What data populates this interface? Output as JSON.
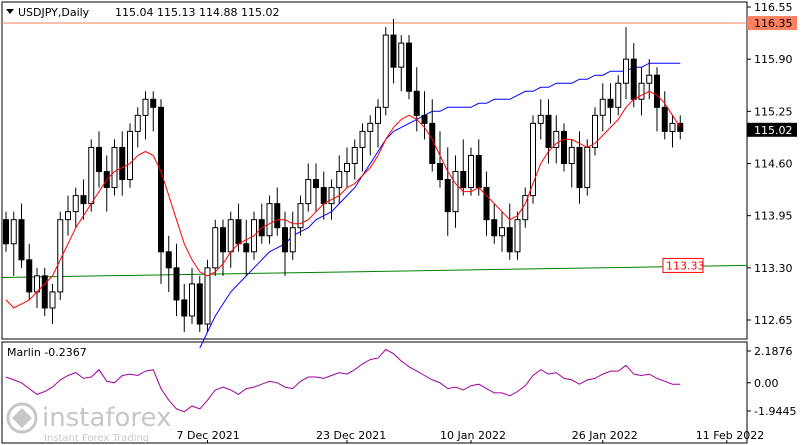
{
  "header": {
    "symbol": "USDJPY,Daily",
    "ohlc": "115.04 115.13 114.88 115.02"
  },
  "indicator": {
    "label": "Marlin -0.2367",
    "ticks": [
      "2.1876",
      "0.00",
      "-1.9445"
    ],
    "values": [
      2.1876,
      0.0,
      -1.9445
    ]
  },
  "watermark": {
    "brand": "instaforex",
    "tagline": "Instant Forex Trading"
  },
  "colors": {
    "ma_fast": "#ff0000",
    "ma_slow": "#0000ff",
    "ma_long": "#008000",
    "marlin": "#a000a0",
    "resistance": "#ff8060",
    "box_red": "#ff0000"
  },
  "chart_data": {
    "type": "candlestick",
    "price_ticks": [
      "116.55",
      "115.90",
      "115.25",
      "114.60",
      "113.95",
      "113.30",
      "112.65"
    ],
    "price_tick_values": [
      116.55,
      115.9,
      115.25,
      114.6,
      113.95,
      113.3,
      112.65
    ],
    "date_labels": [
      "7 Dec 2021",
      "23 Dec 2021",
      "10 Jan 2022",
      "26 Jan 2022",
      "11 Feb 2022"
    ],
    "date_label_index": [
      26,
      44,
      60,
      77,
      93
    ],
    "current_price": "115.02",
    "resistance_label": "116.35",
    "resistance_value": 116.35,
    "long_ma_label": "113.33",
    "candles": [
      [
        113.9,
        114.0,
        113.5,
        113.6
      ],
      [
        113.6,
        114.0,
        113.2,
        113.9
      ],
      [
        113.9,
        114.1,
        113.3,
        113.4
      ],
      [
        113.4,
        113.6,
        112.9,
        113.0
      ],
      [
        113.0,
        113.3,
        112.8,
        113.2
      ],
      [
        113.2,
        113.3,
        112.7,
        112.8
      ],
      [
        112.8,
        113.1,
        112.6,
        113.0
      ],
      [
        113.0,
        114.0,
        112.9,
        113.9
      ],
      [
        113.9,
        114.2,
        113.7,
        114.0
      ],
      [
        114.0,
        114.3,
        113.8,
        114.2
      ],
      [
        114.2,
        114.4,
        113.9,
        114.1
      ],
      [
        114.1,
        114.9,
        114.0,
        114.8
      ],
      [
        114.8,
        115.0,
        114.3,
        114.5
      ],
      [
        114.5,
        114.7,
        114.0,
        114.3
      ],
      [
        114.3,
        114.9,
        114.2,
        114.8
      ],
      [
        114.8,
        115.0,
        114.2,
        114.4
      ],
      [
        114.4,
        115.1,
        114.3,
        115.0
      ],
      [
        115.0,
        115.3,
        114.8,
        115.2
      ],
      [
        115.2,
        115.5,
        114.9,
        115.4
      ],
      [
        115.4,
        115.5,
        115.0,
        115.3
      ],
      [
        115.3,
        115.4,
        113.1,
        113.5
      ],
      [
        113.5,
        113.7,
        113.0,
        113.3
      ],
      [
        113.3,
        113.6,
        112.7,
        112.9
      ],
      [
        112.9,
        113.1,
        112.5,
        112.7
      ],
      [
        112.7,
        113.3,
        112.6,
        113.1
      ],
      [
        113.1,
        113.2,
        112.5,
        112.6
      ],
      [
        112.6,
        113.4,
        112.5,
        113.3
      ],
      [
        113.3,
        113.9,
        113.2,
        113.8
      ],
      [
        113.8,
        113.9,
        113.2,
        113.5
      ],
      [
        113.5,
        114.0,
        113.3,
        113.9
      ],
      [
        113.9,
        114.1,
        113.5,
        113.6
      ],
      [
        113.6,
        113.9,
        113.2,
        113.5
      ],
      [
        113.5,
        114.0,
        113.4,
        113.9
      ],
      [
        113.9,
        114.1,
        113.6,
        113.7
      ],
      [
        113.7,
        114.2,
        113.6,
        114.1
      ],
      [
        114.1,
        114.3,
        113.7,
        113.8
      ],
      [
        113.8,
        114.0,
        113.2,
        113.5
      ],
      [
        113.5,
        114.0,
        113.4,
        113.8
      ],
      [
        113.8,
        114.2,
        113.7,
        114.1
      ],
      [
        114.1,
        114.6,
        114.0,
        114.4
      ],
      [
        114.4,
        114.6,
        114.0,
        114.3
      ],
      [
        114.3,
        114.5,
        113.9,
        114.1
      ],
      [
        114.1,
        114.4,
        113.9,
        114.3
      ],
      [
        114.3,
        114.7,
        114.1,
        114.5
      ],
      [
        114.5,
        114.8,
        114.3,
        114.6
      ],
      [
        114.6,
        114.9,
        114.4,
        114.8
      ],
      [
        114.8,
        115.1,
        114.5,
        115.0
      ],
      [
        115.0,
        115.2,
        114.7,
        115.1
      ],
      [
        115.1,
        115.4,
        114.8,
        115.3
      ],
      [
        115.3,
        116.3,
        115.2,
        116.2
      ],
      [
        116.2,
        116.4,
        115.6,
        115.8
      ],
      [
        115.8,
        116.2,
        115.5,
        116.1
      ],
      [
        116.1,
        116.2,
        115.4,
        115.5
      ],
      [
        115.5,
        115.8,
        115.0,
        115.2
      ],
      [
        115.2,
        115.5,
        114.9,
        115.1
      ],
      [
        115.1,
        115.4,
        114.5,
        114.6
      ],
      [
        114.6,
        115.0,
        114.3,
        114.4
      ],
      [
        114.4,
        114.8,
        113.7,
        114.0
      ],
      [
        114.0,
        114.7,
        113.8,
        114.5
      ],
      [
        114.5,
        114.9,
        114.2,
        114.3
      ],
      [
        114.3,
        114.8,
        114.2,
        114.7
      ],
      [
        114.7,
        114.9,
        114.2,
        114.3
      ],
      [
        114.3,
        114.5,
        113.7,
        113.9
      ],
      [
        113.9,
        114.1,
        113.6,
        113.7
      ],
      [
        113.7,
        114.0,
        113.5,
        113.8
      ],
      [
        113.8,
        114.1,
        113.4,
        113.5
      ],
      [
        113.5,
        114.0,
        113.4,
        113.9
      ],
      [
        113.9,
        114.3,
        113.8,
        114.2
      ],
      [
        114.2,
        115.2,
        114.1,
        115.1
      ],
      [
        115.1,
        115.4,
        114.9,
        115.2
      ],
      [
        115.2,
        115.4,
        114.6,
        114.8
      ],
      [
        114.8,
        115.2,
        114.6,
        115.0
      ],
      [
        115.0,
        115.1,
        114.5,
        114.6
      ],
      [
        114.6,
        114.9,
        114.3,
        114.8
      ],
      [
        114.8,
        115.0,
        114.1,
        114.3
      ],
      [
        114.3,
        114.9,
        114.2,
        114.8
      ],
      [
        114.8,
        115.3,
        114.7,
        115.2
      ],
      [
        115.2,
        115.6,
        115.0,
        115.4
      ],
      [
        115.4,
        115.6,
        115.1,
        115.3
      ],
      [
        115.3,
        115.7,
        115.2,
        115.6
      ],
      [
        115.6,
        116.3,
        115.4,
        115.9
      ],
      [
        115.9,
        116.1,
        115.3,
        115.4
      ],
      [
        115.4,
        115.8,
        115.2,
        115.6
      ],
      [
        115.6,
        115.9,
        115.4,
        115.7
      ],
      [
        115.7,
        115.8,
        115.0,
        115.3
      ],
      [
        115.3,
        115.5,
        114.9,
        115.0
      ],
      [
        115.0,
        115.2,
        114.8,
        115.1
      ],
      [
        115.1,
        115.2,
        114.9,
        115.0
      ]
    ],
    "ma_fast": [
      112.9,
      112.8,
      112.85,
      112.9,
      113.0,
      113.1,
      113.2,
      113.4,
      113.6,
      113.8,
      113.95,
      114.1,
      114.25,
      114.4,
      114.5,
      114.55,
      114.6,
      114.7,
      114.75,
      114.7,
      114.5,
      114.2,
      113.9,
      113.6,
      113.4,
      113.25,
      113.2,
      113.25,
      113.35,
      113.5,
      113.6,
      113.65,
      113.7,
      113.8,
      113.85,
      113.9,
      113.9,
      113.85,
      113.85,
      113.9,
      114.0,
      114.1,
      114.15,
      114.2,
      114.3,
      114.35,
      114.45,
      114.55,
      114.7,
      114.9,
      115.05,
      115.15,
      115.2,
      115.15,
      115.05,
      114.9,
      114.7,
      114.5,
      114.35,
      114.25,
      114.25,
      114.3,
      114.2,
      114.1,
      114.0,
      113.9,
      113.95,
      114.1,
      114.35,
      114.6,
      114.75,
      114.85,
      114.9,
      114.9,
      114.85,
      114.8,
      114.85,
      114.95,
      115.05,
      115.15,
      115.3,
      115.4,
      115.45,
      115.5,
      115.45,
      115.35,
      115.2,
      115.05
    ],
    "ma_slow": [
      null,
      null,
      null,
      null,
      null,
      null,
      null,
      null,
      null,
      null,
      null,
      null,
      null,
      null,
      null,
      null,
      null,
      null,
      null,
      null,
      null,
      null,
      null,
      null,
      null,
      112.3,
      112.5,
      112.7,
      112.85,
      113.0,
      113.1,
      113.2,
      113.3,
      113.4,
      113.5,
      113.55,
      113.6,
      113.7,
      113.75,
      113.8,
      113.9,
      113.95,
      114.0,
      114.1,
      114.2,
      114.3,
      114.45,
      114.6,
      114.75,
      114.9,
      115.0,
      115.05,
      115.1,
      115.15,
      115.2,
      115.25,
      115.25,
      115.3,
      115.3,
      115.3,
      115.3,
      115.35,
      115.35,
      115.4,
      115.4,
      115.4,
      115.45,
      115.5,
      115.5,
      115.55,
      115.55,
      115.6,
      115.6,
      115.6,
      115.65,
      115.65,
      115.7,
      115.7,
      115.75,
      115.75,
      115.75,
      115.8,
      115.8,
      115.85,
      115.85,
      115.85,
      115.85,
      115.85
    ],
    "ma_long_start": 113.18,
    "ma_long_end": 113.33,
    "marlin": [
      0.4,
      0.2,
      0.0,
      -0.4,
      -0.8,
      -0.6,
      -0.3,
      0.2,
      0.5,
      0.7,
      0.3,
      0.4,
      0.9,
      0.1,
      0.0,
      0.5,
      0.6,
      0.5,
      0.8,
      0.9,
      -0.4,
      -1.2,
      -1.8,
      -2.0,
      -1.6,
      -1.8,
      -1.2,
      -0.5,
      -0.3,
      -0.5,
      -0.8,
      -0.4,
      -0.3,
      -0.1,
      0.1,
      0.0,
      -0.3,
      -0.4,
      0.1,
      0.4,
      0.4,
      0.3,
      0.5,
      0.7,
      0.6,
      0.9,
      1.3,
      1.6,
      1.7,
      2.3,
      2.0,
      1.5,
      1.1,
      0.8,
      0.5,
      0.2,
      0.0,
      -0.4,
      -0.3,
      -0.5,
      -0.2,
      -0.1,
      -0.4,
      -0.7,
      -0.7,
      -0.9,
      -0.6,
      -0.2,
      0.5,
      0.9,
      0.6,
      0.7,
      0.3,
      0.2,
      -0.1,
      0.2,
      0.3,
      0.6,
      0.8,
      0.8,
      1.2,
      0.6,
      0.5,
      0.6,
      0.3,
      0.1,
      -0.1,
      -0.1
    ]
  }
}
